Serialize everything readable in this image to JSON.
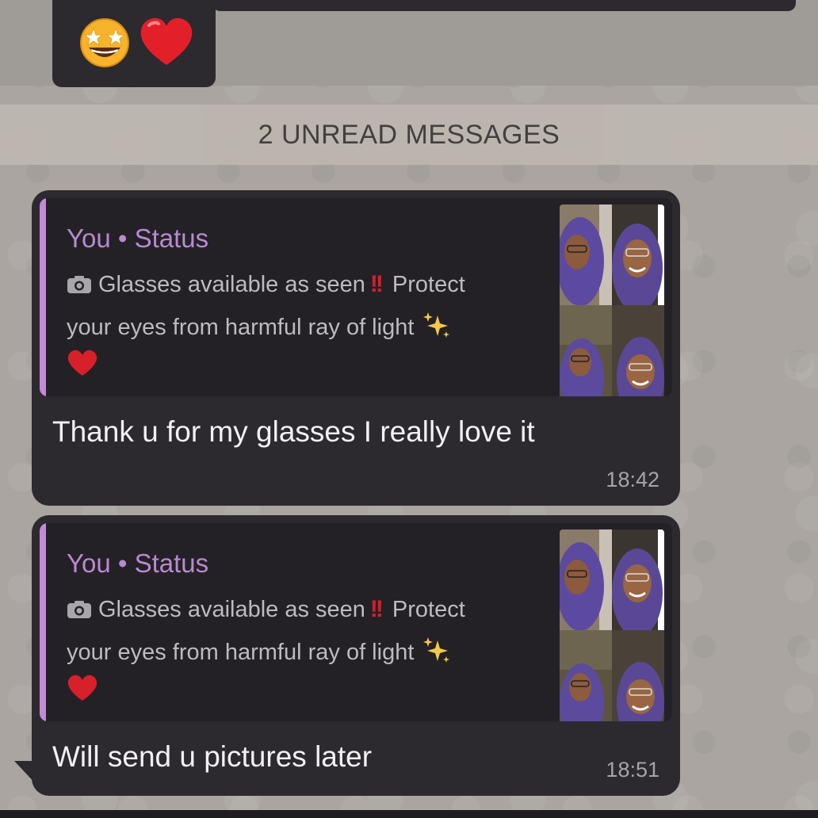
{
  "previous_message": {
    "emojis": [
      "star-struck",
      "red-heart"
    ]
  },
  "unread_banner": {
    "label": "2 UNREAD MESSAGES"
  },
  "messages": [
    {
      "quote": {
        "author": "You • Status",
        "line1": "Glasses available as seen",
        "line1_after": "Protect",
        "line2": "your eyes from harmful ray of light",
        "icons": [
          "camera-icon",
          "double-exclamation-icon",
          "sparkles-icon",
          "red-heart-icon"
        ]
      },
      "text": "Thank u for my glasses I really love it",
      "time": "18:42"
    },
    {
      "quote": {
        "author": "You • Status",
        "line1": "Glasses available as seen",
        "line1_after": "Protect",
        "line2": "your eyes from harmful ray of light",
        "icons": [
          "camera-icon",
          "double-exclamation-icon",
          "sparkles-icon",
          "red-heart-icon"
        ]
      },
      "text": "Will send u pictures later",
      "time": "18:51"
    }
  ],
  "colors": {
    "bubble": "#2c2a2f",
    "quote_bg": "#232126",
    "quote_bar": "#c48ad6",
    "author": "#b88ad0",
    "banner": "#bdb7b0"
  }
}
